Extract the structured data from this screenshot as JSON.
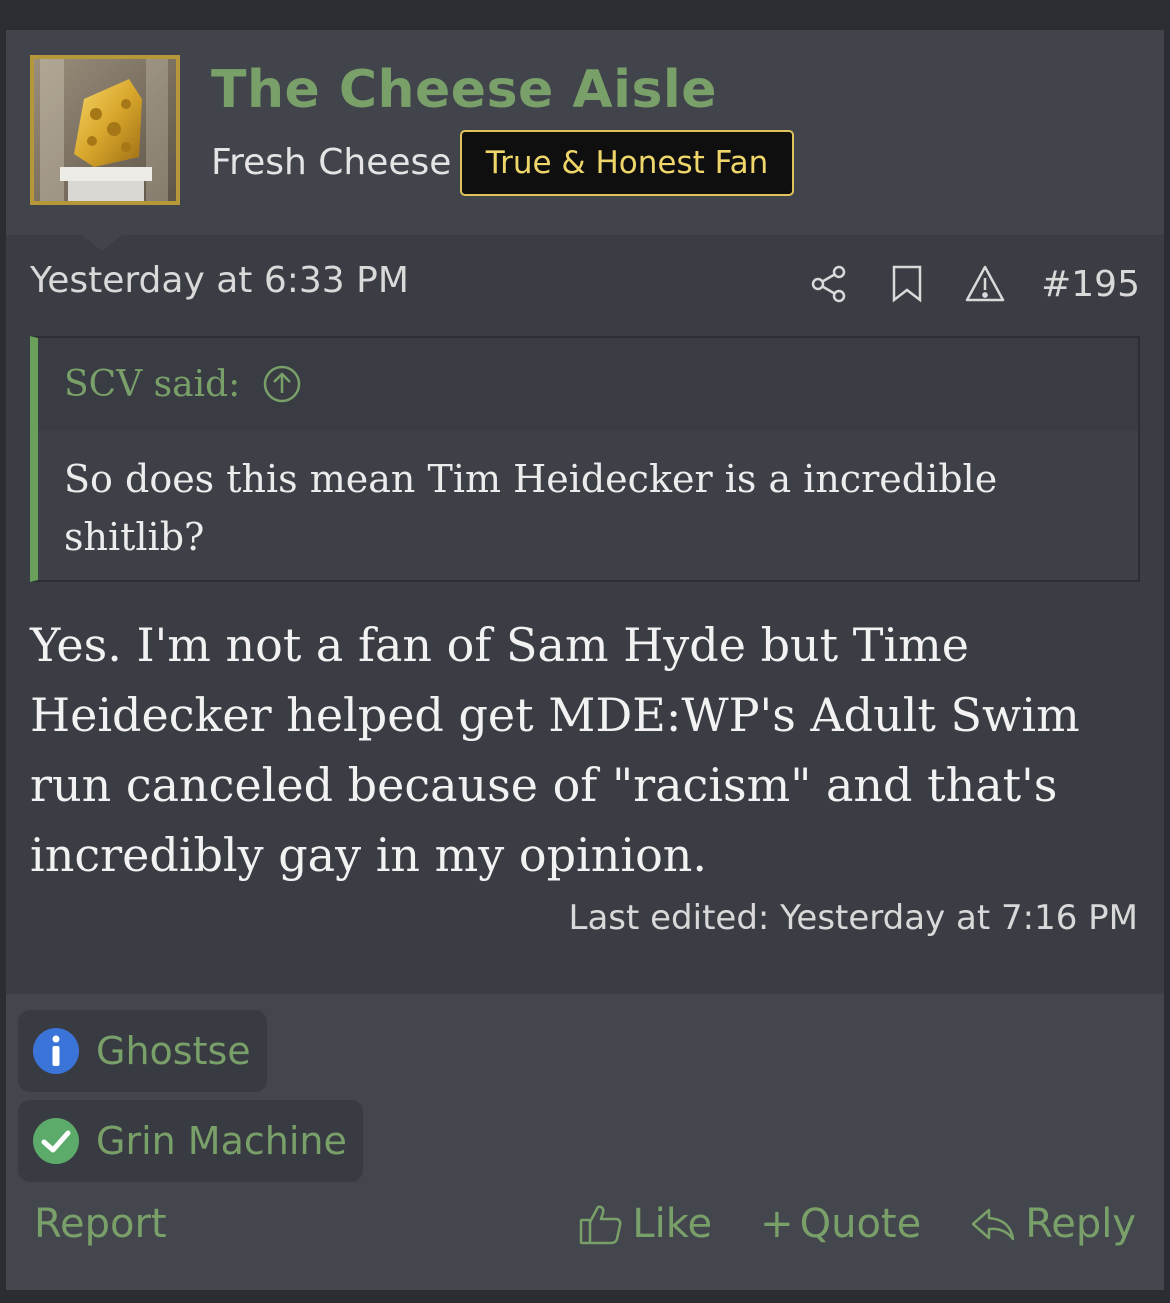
{
  "user": {
    "name": "The Cheese Aisle",
    "title": "Fresh Cheese",
    "banner": "True & Honest Fan",
    "avatar_icon": "golden-cheese-trophy"
  },
  "post": {
    "date": "Yesterday at 6:33 PM",
    "number": "#195",
    "icons": [
      "share-icon",
      "bookmark-icon",
      "report-warning-icon"
    ],
    "quote": {
      "author_said": "SCV said:",
      "text": "So does this mean Tim Heidecker is a incredible shitlib?"
    },
    "message": "Yes. I'm not a fan of Sam Hyde but Time Heidecker helped get MDE:WP's Adult Swim run canceled because of \"racism\" and that's incredibly gay in my opinion.",
    "edited": "Last edited: Yesterday at 7:16 PM"
  },
  "reactions": [
    {
      "label": "Ghostse",
      "icon": "info-icon",
      "color": "#3b74d9"
    },
    {
      "label": "Grin Machine",
      "icon": "check-icon",
      "color": "#5cab6a"
    }
  ],
  "actions": {
    "report": "Report",
    "like": "Like",
    "quote": "Quote",
    "quote_prefix": "+",
    "reply": "Reply"
  },
  "colors": {
    "accent_green": "#7aa06a",
    "banner_gold": "#efd66a",
    "background": "#3a3d43"
  }
}
